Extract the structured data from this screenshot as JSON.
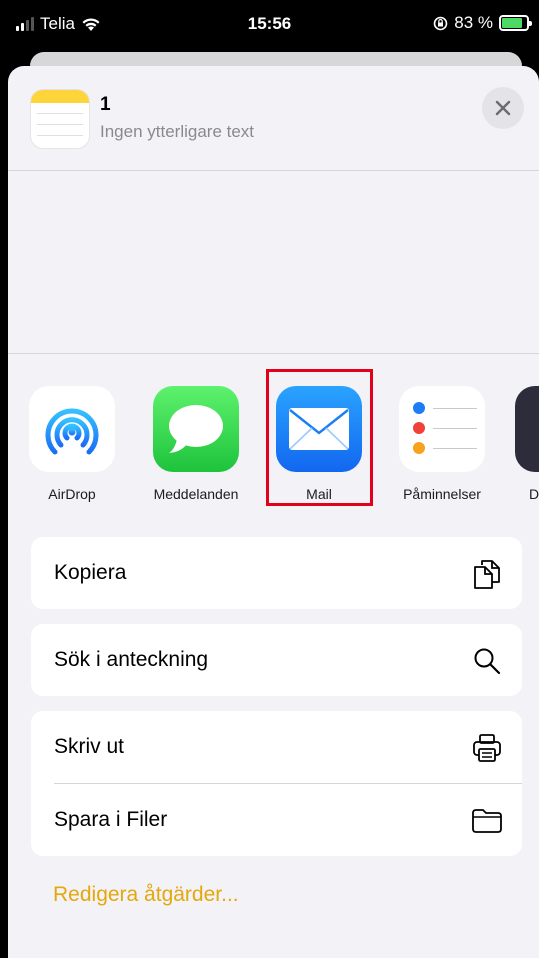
{
  "status_bar": {
    "carrier": "Telia",
    "time": "15:56",
    "battery": "83 %",
    "battery_level": 0.83
  },
  "sheet_header": {
    "title": "1",
    "subtitle": "Ingen ytterligare text"
  },
  "apps": [
    {
      "label": "AirDrop",
      "icon": "airdrop-icon"
    },
    {
      "label": "Meddelanden",
      "icon": "messages-icon"
    },
    {
      "label": "Mail",
      "icon": "mail-icon",
      "highlighted": true
    },
    {
      "label": "Påminnelser",
      "icon": "reminders-icon"
    },
    {
      "label": "D",
      "icon": "app-icon"
    }
  ],
  "reminder_dot_colors": [
    "#1e7cf5",
    "#f0413a",
    "#f7a21b"
  ],
  "actions": {
    "group1": [
      {
        "label": "Kopiera",
        "icon": "copy-icon"
      }
    ],
    "group2": [
      {
        "label": "Sök i anteckning",
        "icon": "search-icon"
      }
    ],
    "group3": [
      {
        "label": "Skriv ut",
        "icon": "print-icon"
      },
      {
        "label": "Spara i Filer",
        "icon": "folder-icon"
      }
    ]
  },
  "edit_actions_label": "Redigera åtgärder...",
  "colors": {
    "accent": "#e5a80c",
    "highlight_border": "#e3001b",
    "sheet_bg": "#f2f2f7"
  }
}
